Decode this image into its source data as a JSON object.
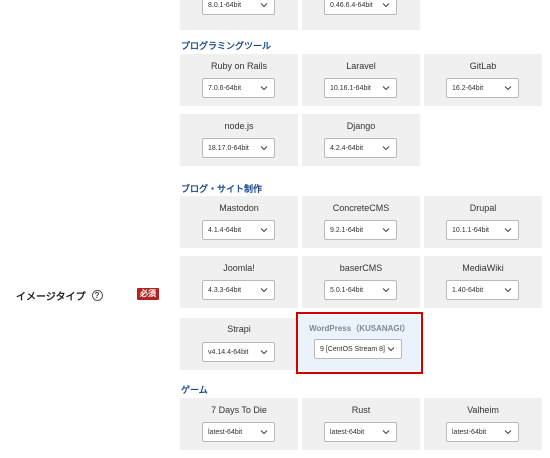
{
  "field": {
    "label": "イメージタイプ",
    "help_glyph": "?",
    "required": "必須"
  },
  "sections": {
    "prog": "プログラミングツール",
    "blog": "ブログ・サイト制作",
    "game": "ゲーム"
  },
  "cards": {
    "top1": {
      "version": "8.0.1-64bit"
    },
    "top2": {
      "version": "0.46.6.4-64bit"
    },
    "ruby": {
      "name": "Ruby on Rails",
      "version": "7.0.6-64bit"
    },
    "laravel": {
      "name": "Laravel",
      "version": "10.16.1-64bit"
    },
    "gitlab": {
      "name": "GitLab",
      "version": "16.2-64bit"
    },
    "nodejs": {
      "name": "node.js",
      "version": "18.17.0-64bit"
    },
    "django": {
      "name": "Django",
      "version": "4.2.4-64bit"
    },
    "mastodon": {
      "name": "Mastodon",
      "version": "4.1.4-64bit"
    },
    "concretecms": {
      "name": "ConcreteCMS",
      "version": "9.2.1-64bit"
    },
    "drupal": {
      "name": "Drupal",
      "version": "10.1.1-64bit"
    },
    "joomla": {
      "name": "Joomla!",
      "version": "4.3.3-64bit"
    },
    "basercms": {
      "name": "baserCMS",
      "version": "5.0.1-64bit"
    },
    "mediawiki": {
      "name": "MediaWiki",
      "version": "1.40-64bit"
    },
    "strapi": {
      "name": "Strapi",
      "version": "v4.14.4-64bit"
    },
    "wordpress": {
      "name": "WordPress（KUSANAGI）",
      "version": "9 [CentOS Stream 8]"
    },
    "7dtd": {
      "name": "7 Days To Die",
      "version": "latest-64bit"
    },
    "rust": {
      "name": "Rust",
      "version": "latest-64bit"
    },
    "valheim": {
      "name": "Valheim",
      "version": "latest-64bit"
    }
  },
  "colors": {
    "highlight": "#d00000",
    "heading": "#1a4a8a",
    "badge": "#b22222",
    "selected_bg": "#eaf3fb"
  },
  "icons": {
    "dropdown": "chevron-down-icon",
    "help": "question-circle-icon"
  }
}
